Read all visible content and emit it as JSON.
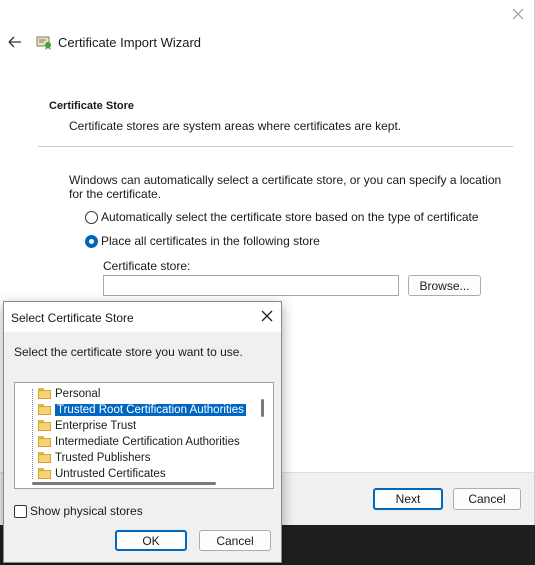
{
  "wizard": {
    "title": "Certificate Import Wizard",
    "section_title": "Certificate Store",
    "section_desc": "Certificate stores are system areas where certificates are kept.",
    "intro": "Windows can automatically select a certificate store, or you can specify a location for the certificate.",
    "radio_auto": "Automatically select the certificate store based on the type of certificate",
    "radio_manual": "Place all certificates in the following store",
    "selected_option": "manual",
    "store_label": "Certificate store:",
    "store_value": "",
    "browse_label": "Browse...",
    "next_label": "Next",
    "cancel_label": "Cancel"
  },
  "dialog": {
    "title": "Select Certificate Store",
    "desc": "Select the certificate store you want to use.",
    "stores": [
      {
        "label": "Personal",
        "selected": false
      },
      {
        "label": "Trusted Root Certification Authorities",
        "selected": true
      },
      {
        "label": "Enterprise Trust",
        "selected": false
      },
      {
        "label": "Intermediate Certification Authorities",
        "selected": false
      },
      {
        "label": "Trusted Publishers",
        "selected": false
      },
      {
        "label": "Untrusted Certificates",
        "selected": false
      }
    ],
    "show_physical_label": "Show physical stores",
    "show_physical_checked": false,
    "ok_label": "OK",
    "cancel_label": "Cancel"
  },
  "icons": {
    "close": "close-icon",
    "back": "back-arrow-icon",
    "wizard": "certificate-icon",
    "folder": "folder-icon"
  },
  "colors": {
    "accent": "#0067c0",
    "selection": "#0067c0"
  }
}
